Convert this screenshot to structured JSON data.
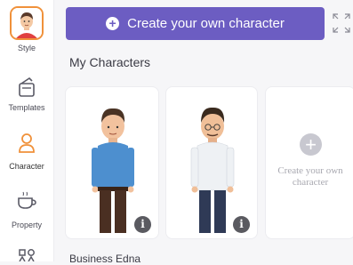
{
  "sidebar": {
    "items": [
      {
        "label": "Style",
        "icon": "avatar-icon",
        "active": true
      },
      {
        "label": "Templates",
        "icon": "templates-icon"
      },
      {
        "label": "Character",
        "icon": "character-icon",
        "active": true
      },
      {
        "label": "Property",
        "icon": "property-icon"
      },
      {
        "label": "",
        "icon": "shapes-icon"
      }
    ],
    "active_color": "#f0913a"
  },
  "toolbar": {
    "create_label": "Create your own character",
    "expand_icon": "expand-icon"
  },
  "main": {
    "heading": "My Characters",
    "cards": [
      {
        "type": "character",
        "shirt_color": "#4d8fcf",
        "pants_color": "#4a2f22",
        "info_icon": "info-icon"
      },
      {
        "type": "character",
        "shirt_color": "#eef1f4",
        "pants_color": "#2f3a56",
        "info_icon": "info-icon"
      }
    ],
    "create_card": {
      "line1": "Create your own",
      "line2": "character"
    },
    "partial_label": "Business Edna"
  },
  "colors": {
    "accent": "#6c5dc2"
  }
}
